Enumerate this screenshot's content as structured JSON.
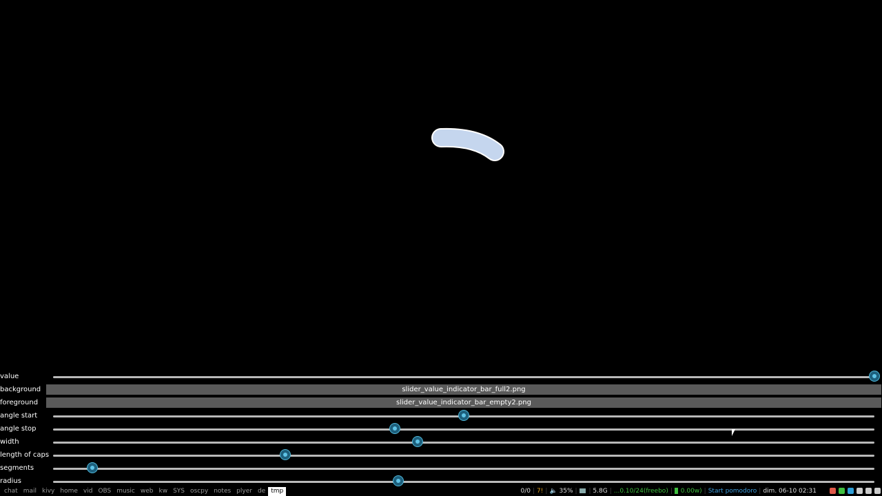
{
  "controls": {
    "value": {
      "label": "value",
      "fraction": 1.0
    },
    "background": {
      "label": "background",
      "file": "slider_value_indicator_bar_full2.png"
    },
    "foreground": {
      "label": "foreground",
      "file": "slider_value_indicator_bar_empty2.png"
    },
    "angle_start": {
      "label": "angle start",
      "fraction": 0.5
    },
    "angle_stop": {
      "label": "angle stop",
      "fraction": 0.416
    },
    "width": {
      "label": "width",
      "fraction": 0.444
    },
    "length_of_caps": {
      "label": "length of caps",
      "fraction": 0.283
    },
    "segments": {
      "label": "segments",
      "fraction": 0.048
    },
    "radius": {
      "label": "radius",
      "fraction": 0.42
    }
  },
  "taskbar": {
    "workspaces": [
      "chat",
      "mail",
      "kivy",
      "home",
      "vid",
      "OBS",
      "music",
      "web",
      "kw",
      "SYS",
      "oscpy",
      "notes",
      "plyer",
      "de",
      "tmp"
    ],
    "active_workspace": "tmp",
    "status": {
      "counter": "0/0",
      "alert": "7!",
      "volume": "35%",
      "memory": "5.8G",
      "load": "...0.10/24(freebo)",
      "power": "0.00w)",
      "pomodoro": "Start pomodoro",
      "datetime": "dim. 06-10 02:31"
    },
    "colors": {
      "alert": "#e0a020",
      "load": "#3fbf3f",
      "power": "#3fbf3f",
      "pomodoro": "#3f9fdf"
    },
    "tray_icons": [
      "flag-icon",
      "check-icon",
      "telegram-icon",
      "network-icon",
      "battery-icon",
      "power-icon"
    ]
  }
}
